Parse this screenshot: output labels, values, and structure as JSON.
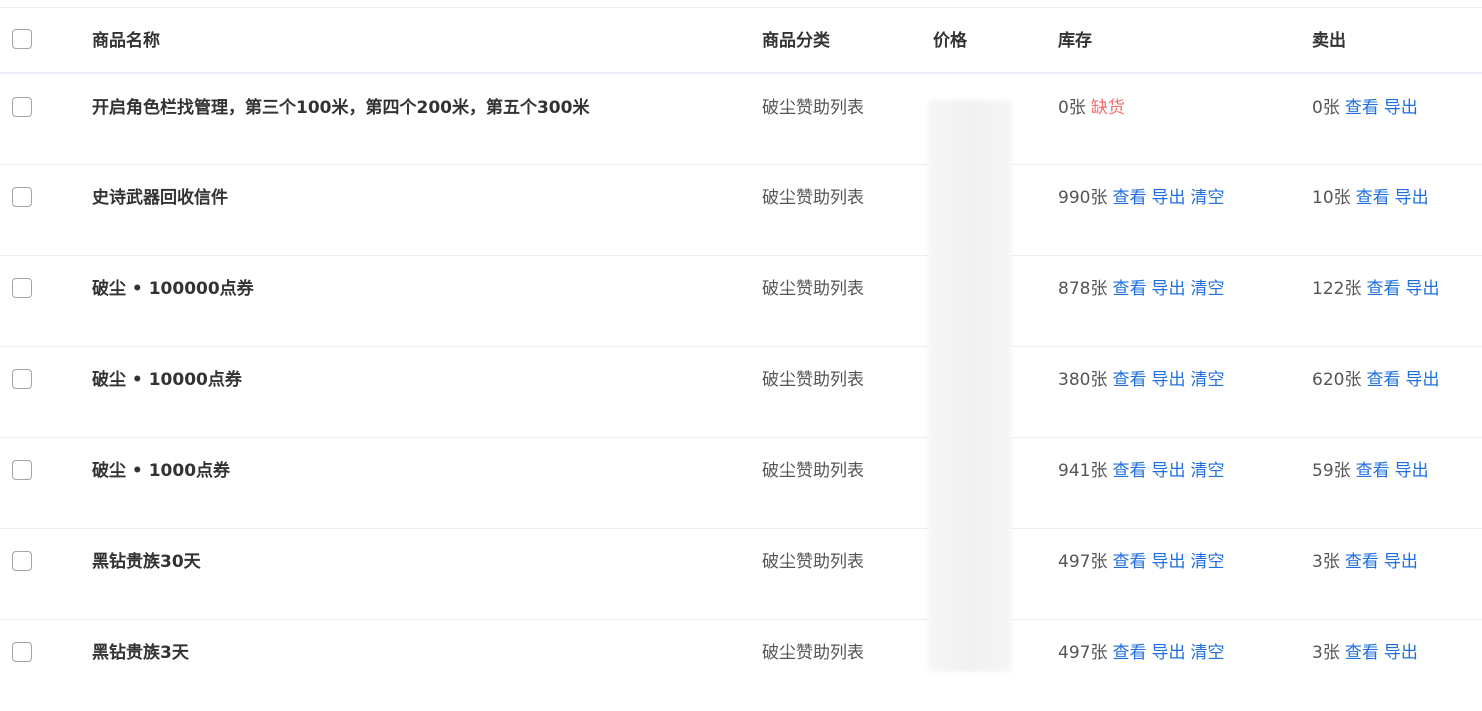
{
  "header": {
    "name": "商品名称",
    "category": "商品分类",
    "price": "价格",
    "stock": "库存",
    "sold": "卖出"
  },
  "rows": [
    {
      "name": "开启角色栏找管理，第三个100米，第四个200米，第五个300米",
      "category": "破尘赞助列表",
      "stock": "0张",
      "stock_status": "缺货",
      "sold": "0张",
      "view": "查看",
      "export": "导出"
    },
    {
      "name": "史诗武器回收信件",
      "category": "破尘赞助列表",
      "stock": "990张",
      "stock_view": "查看",
      "stock_export": "导出",
      "stock_clear": "清空",
      "sold": "10张",
      "view": "查看",
      "export": "导出"
    },
    {
      "name": "破尘 • 100000点券",
      "category": "破尘赞助列表",
      "stock": "878张",
      "stock_view": "查看",
      "stock_export": "导出",
      "stock_clear": "清空",
      "sold": "122张",
      "view": "查看",
      "export": "导出"
    },
    {
      "name": "破尘 • 10000点券",
      "category": "破尘赞助列表",
      "stock": "380张",
      "stock_view": "查看",
      "stock_export": "导出",
      "stock_clear": "清空",
      "sold": "620张",
      "view": "查看",
      "export": "导出"
    },
    {
      "name": "破尘 • 1000点券",
      "category": "破尘赞助列表",
      "stock": "941张",
      "stock_view": "查看",
      "stock_export": "导出",
      "stock_clear": "清空",
      "sold": "59张",
      "view": "查看",
      "export": "导出"
    },
    {
      "name": "黑钻贵族30天",
      "category": "破尘赞助列表",
      "stock": "497张",
      "stock_view": "查看",
      "stock_export": "导出",
      "stock_clear": "清空",
      "sold": "3张",
      "view": "查看",
      "export": "导出"
    },
    {
      "name": "黑钻贵族3天",
      "category": "破尘赞助列表",
      "stock": "497张",
      "stock_view": "查看",
      "stock_export": "导出",
      "stock_clear": "清空",
      "sold": "3张",
      "view": "查看",
      "export": "导出"
    }
  ],
  "colors": {
    "link": "#1f6fe0",
    "out_of_stock": "#f56c6c",
    "border": "#ebeef5"
  }
}
